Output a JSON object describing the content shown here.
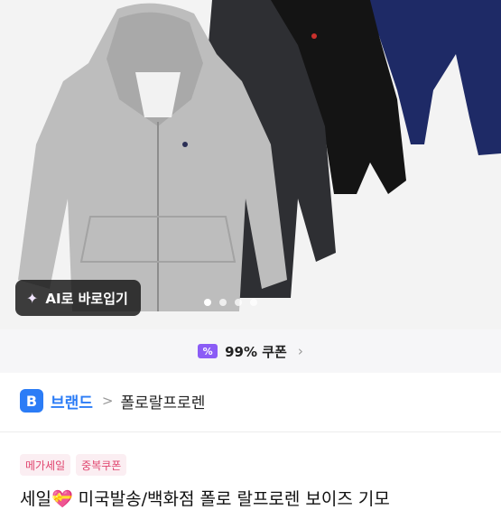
{
  "ai_button": {
    "label": "AI로 바로입기",
    "icon": "magic-wand-icon"
  },
  "carousel": {
    "count": 4,
    "active_index": 0
  },
  "coupon": {
    "badge": "%",
    "text": "99% 쿠폰",
    "chevron": "›"
  },
  "brand": {
    "badge": "B",
    "label": "브랜드",
    "separator": ">",
    "name": "폴로랄프로렌"
  },
  "tags": [
    "메가세일",
    "중복쿠폰"
  ],
  "product_title": "세일💝 미국발송/백화점 폴로 랄프로렌 보이즈 기모",
  "colors": {
    "accent_blue": "#2b7cf6",
    "coupon_purple": "#8b5cf6",
    "tag_pink": "#e0456f"
  }
}
